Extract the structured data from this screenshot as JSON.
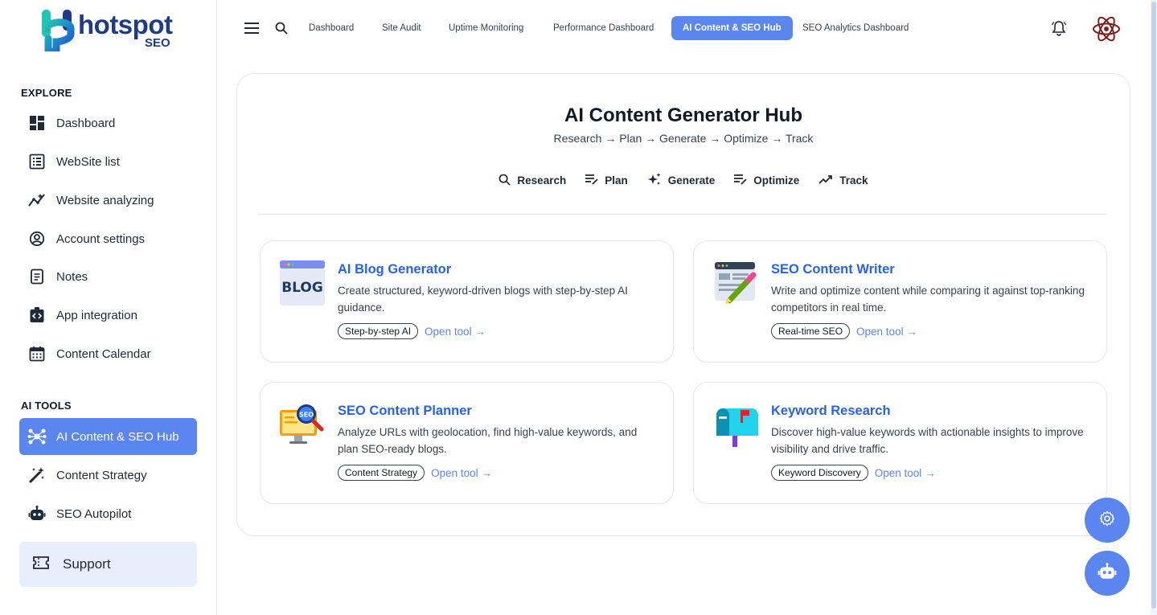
{
  "brand": {
    "name": "hotspot",
    "sub": "SEO"
  },
  "sidebar": {
    "explore_label": "EXPLORE",
    "explore_items": [
      {
        "label": "Dashboard",
        "icon": "dashboard-icon"
      },
      {
        "label": "WebSite list",
        "icon": "list-icon"
      },
      {
        "label": "Website analyzing",
        "icon": "analytics-icon"
      },
      {
        "label": "Account settings",
        "icon": "account-icon"
      },
      {
        "label": "Notes",
        "icon": "notes-icon"
      },
      {
        "label": "App integration",
        "icon": "integration-icon"
      },
      {
        "label": "Content Calendar",
        "icon": "calendar-icon"
      }
    ],
    "ai_label": "AI TOOLS",
    "ai_items": [
      {
        "label": "AI Content & SEO Hub",
        "icon": "hub-icon",
        "active": true
      },
      {
        "label": "Content Strategy",
        "icon": "magic-wand-icon"
      },
      {
        "label": "SEO Autopilot",
        "icon": "robot-icon"
      }
    ],
    "support_label": "Support"
  },
  "topbar": {
    "tabs": [
      {
        "label": "Dashboard"
      },
      {
        "label": "Site Audit"
      },
      {
        "label": "Uptime Monitoring"
      },
      {
        "label": "Performance Dashboard"
      },
      {
        "label": "AI Content & SEO Hub",
        "active": true
      },
      {
        "label": "SEO Analytics Dashboard"
      }
    ]
  },
  "hub": {
    "title": "AI Content Generator Hub",
    "subtitle": "Research → Plan → Generate → Optimize → Track",
    "steps": [
      {
        "label": "Research",
        "icon": "search-icon"
      },
      {
        "label": "Plan",
        "icon": "plan-icon"
      },
      {
        "label": "Generate",
        "icon": "sparkle-icon"
      },
      {
        "label": "Optimize",
        "icon": "optimize-icon"
      },
      {
        "label": "Track",
        "icon": "trending-icon"
      }
    ],
    "tools": [
      {
        "title": "AI Blog Generator",
        "desc": "Create structured, keyword-driven blogs with step-by-step AI guidance.",
        "badge": "Step-by-step AI",
        "link": "Open tool →"
      },
      {
        "title": "SEO Content Writer",
        "desc": "Write and optimize content while comparing it against top-ranking competitors in real time.",
        "badge": "Real-time SEO",
        "link": "Open tool →"
      },
      {
        "title": "SEO Content Planner",
        "desc": "Analyze URLs with geolocation, find high-value keywords, and plan SEO-ready blogs.",
        "badge": "Content Strategy",
        "link": "Open tool →"
      },
      {
        "title": "Keyword Research",
        "desc": "Discover high-value keywords with actionable insights to improve visibility and drive traffic.",
        "badge": "Keyword Discovery",
        "link": "Open tool →"
      }
    ],
    "blog_icon_text": "BLOG",
    "seo_icon_text": "SEO"
  },
  "colors": {
    "accent": "#5b86f0",
    "link": "#2563eb",
    "brand": "#1e3a8a",
    "teal": "#14b8a6"
  }
}
